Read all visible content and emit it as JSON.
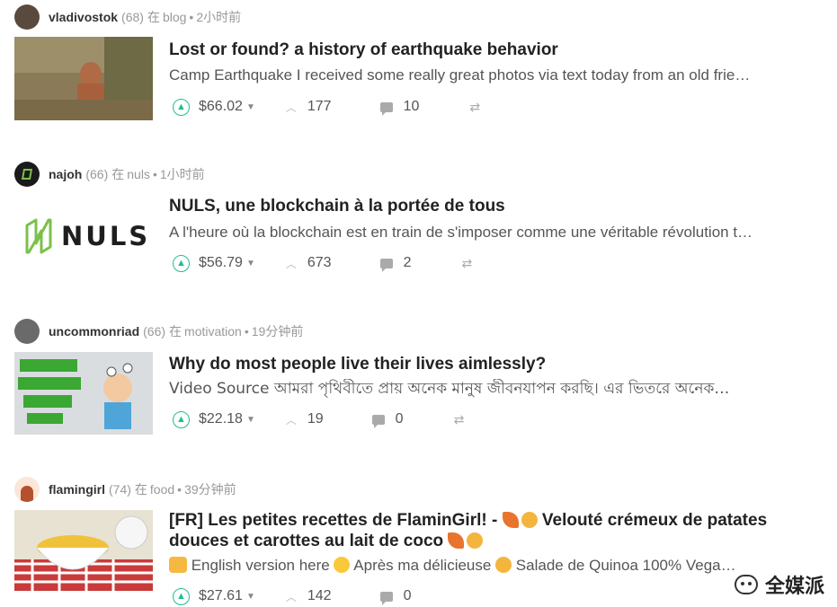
{
  "labels": {
    "in": "在"
  },
  "posts": [
    {
      "author": "vladivostok",
      "rep": "(68)",
      "category": "blog",
      "time": "2小时前",
      "title": "Lost or found? a history of earthquake behavior",
      "excerpt": "Camp Earthquake I received some really great photos via text today from an old frie…",
      "payout": "$66.02",
      "votes": "177",
      "comments": "10"
    },
    {
      "author": "najoh",
      "rep": "(66)",
      "category": "nuls",
      "time": "1小时前",
      "title": "NULS, une blockchain à la portée de tous",
      "excerpt": "A l'heure où la blockchain est en train de s'imposer comme une véritable révolution t…",
      "payout": "$56.79",
      "votes": "673",
      "comments": "2",
      "thumb_text": "NULS"
    },
    {
      "author": "uncommonriad",
      "rep": "(66)",
      "category": "motivation",
      "time": "19分钟前",
      "title": "Why do most people live their lives aimlessly?",
      "excerpt": "Video Source আমরা পৃথিবীতে প্রায় অনেক মানুষ জীবনযাপন করছি। এর ভিতরে অনেক…",
      "payout": "$22.18",
      "votes": "19",
      "comments": "0"
    },
    {
      "author": "flamingirl",
      "rep": "(74)",
      "category": "food",
      "time": "39分钟前",
      "title_part1": "[FR] Les petites recettes de FlaminGirl! - ",
      "title_part2": " Velouté crémeux de patates",
      "title_line2": "douces et carottes au lait de coco ",
      "excerpt_part1": " English version here ",
      "excerpt_part2": " Après ma délicieuse ",
      "excerpt_part3": " Salade de Quinoa 100% Vega…",
      "payout": "$27.61",
      "votes": "142",
      "comments": "0"
    }
  ],
  "watermark": {
    "text": "全媒派"
  },
  "colors": {
    "upvote": "#1fbf8f",
    "nuls_green": "#7cc04b"
  }
}
